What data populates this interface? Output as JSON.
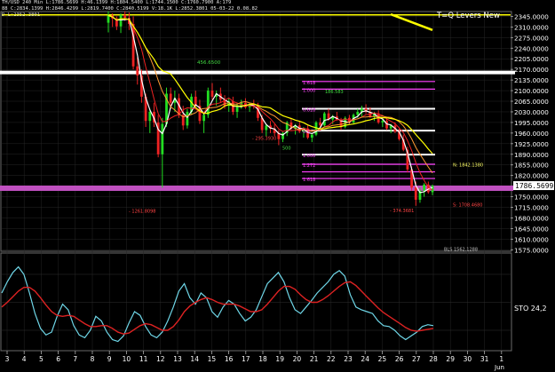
{
  "header": {
    "line1": "TH/USD 240 Min  L:1786.5699  H:46.1399  H:1804.5400  L:1744.1500  C:1760.7900  A:179",
    "line2": "88  C:2834.1399 H:2846.4299 L:2819.7400  C:2840.5199  V:18.1K  L:2852.3801  05-03-22  0.08.82",
    "line3": "D  L:2352.3801"
  },
  "chart_data": [
    {
      "type": "candlestick",
      "title": "",
      "y_ticks": [
        2345,
        2310,
        2275,
        2240,
        2205,
        2170,
        2135,
        2100,
        2065,
        2030,
        1995,
        1960,
        1925,
        1890,
        1855,
        1820,
        1786.5699,
        1750,
        1715,
        1680,
        1645,
        1610,
        1575
      ],
      "y_tick_labels": [
        "2345.0000",
        "2310.0000",
        "2275.0000",
        "2240.0000",
        "2205.0000",
        "2170.0000",
        "2135.0000",
        "2100.0000",
        "2065.0000",
        "2030.0000",
        "1995.0000",
        "1960.0000",
        "1925.0000",
        "1890.0000",
        "1855.0000",
        "1820.0000",
        "1786.5699",
        "1750.0000",
        "1715.0000",
        "1680.0000",
        "1645.0000",
        "1610.0000",
        "1575.0000"
      ],
      "ylim": [
        1570,
        2358
      ],
      "x_tick_labels": [
        "3",
        "4",
        "5",
        "6",
        "7",
        "8",
        "9",
        "10",
        "11",
        "12",
        "13",
        "14",
        "15",
        "16",
        "17",
        "18",
        "19",
        "20",
        "21",
        "22",
        "23",
        "24",
        "25",
        "26",
        "27",
        "28",
        "29",
        "30",
        "31",
        "1"
      ],
      "x_sub_label": "Jun",
      "price_tag": "1786.5699",
      "series": [
        {
          "values": [
            [
              2324,
              2362,
              2292,
              2348
            ],
            [
              2348,
              2355,
              2310,
              2338
            ],
            [
              2338,
              2345,
              2300,
              2312
            ],
            [
              2312,
              2355,
              2290,
              2350
            ],
            [
              2350,
              2362,
              2330,
              2340
            ],
            [
              2340,
              2358,
              2300,
              2320
            ],
            [
              2320,
              2345,
              2170,
              2180
            ],
            [
              2180,
              2210,
              2120,
              2150
            ],
            [
              2150,
              2170,
              2060,
              2080
            ],
            [
              2080,
              2090,
              1980,
              2000
            ],
            [
              2000,
              2040,
              1960,
              2030
            ],
            [
              2030,
              2060,
              1980,
              1995
            ],
            [
              1995,
              2020,
              1880,
              1890
            ],
            [
              1890,
              2010,
              1780,
              1990
            ],
            [
              1990,
              2110,
              1980,
              2090
            ],
            [
              2090,
              2110,
              2040,
              2060
            ],
            [
              2060,
              2100,
              2030,
              2075
            ],
            [
              2075,
              2090,
              2010,
              2020
            ],
            [
              2020,
              2050,
              1970,
              1985
            ],
            [
              1985,
              2040,
              1975,
              2030
            ],
            [
              2030,
              2090,
              2020,
              2080
            ],
            [
              2080,
              2100,
              2040,
              2050
            ],
            [
              2050,
              2070,
              1990,
              2000
            ],
            [
              2000,
              2030,
              1960,
              2020
            ],
            [
              2020,
              2110,
              2010,
              2100
            ],
            [
              2100,
              2125,
              2070,
              2080
            ],
            [
              2080,
              2100,
              2050,
              2090
            ],
            [
              2090,
              2110,
              2060,
              2070
            ],
            [
              2070,
              2085,
              2040,
              2050
            ],
            [
              2050,
              2075,
              2030,
              2065
            ],
            [
              2065,
              2080,
              2020,
              2030
            ],
            [
              2030,
              2060,
              2010,
              2050
            ],
            [
              2050,
              2070,
              2040,
              2060
            ],
            [
              2060,
              2075,
              2040,
              2045
            ],
            [
              2045,
              2060,
              2030,
              2055
            ],
            [
              2055,
              2070,
              2040,
              2050
            ],
            [
              2050,
              2060,
              2000,
              2010
            ],
            [
              2010,
              2020,
              1960,
              1970
            ],
            [
              1970,
              1990,
              1950,
              1985
            ],
            [
              1985,
              2000,
              1960,
              1975
            ],
            [
              1975,
              1990,
              1950,
              1960
            ],
            [
              1960,
              1970,
              1920,
              1940
            ],
            [
              1940,
              1965,
              1930,
              1960
            ],
            [
              1960,
              2000,
              1950,
              1995
            ],
            [
              1995,
              2010,
              1970,
              1975
            ],
            [
              1975,
              1990,
              1955,
              1985
            ],
            [
              1985,
              2000,
              1960,
              1965
            ],
            [
              1965,
              1980,
              1945,
              1975
            ],
            [
              1975,
              1985,
              1940,
              1945
            ],
            [
              1945,
              1960,
              1930,
              1955
            ],
            [
              1955,
              2000,
              1950,
              1995
            ],
            [
              1995,
              2010,
              1980,
              1985
            ],
            [
              1985,
              2030,
              1980,
              2025
            ],
            [
              2025,
              2040,
              2000,
              2005
            ],
            [
              2005,
              2020,
              1990,
              2015
            ],
            [
              2015,
              2030,
              2000,
              2005
            ],
            [
              2005,
              2010,
              1970,
              1980
            ],
            [
              1980,
              2015,
              1975,
              2010
            ],
            [
              2010,
              2020,
              1990,
              1995
            ],
            [
              1995,
              2025,
              1990,
              2020
            ],
            [
              2020,
              2040,
              2010,
              2030
            ],
            [
              2030,
              2050,
              2015,
              2040
            ],
            [
              2040,
              2055,
              2025,
              2030
            ],
            [
              2030,
              2045,
              2010,
              2015
            ],
            [
              2015,
              2030,
              2000,
              2025
            ],
            [
              2025,
              2035,
              1990,
              1995
            ],
            [
              1995,
              2005,
              1980,
              2000
            ],
            [
              2000,
              2010,
              1970,
              1975
            ],
            [
              1975,
              1990,
              1960,
              1985
            ],
            [
              1985,
              1995,
              1960,
              1965
            ],
            [
              1965,
              1975,
              1935,
              1940
            ],
            [
              1940,
              1955,
              1900,
              1905
            ],
            [
              1905,
              1915,
              1830,
              1840
            ],
            [
              1840,
              1850,
              1770,
              1780
            ],
            [
              1780,
              1800,
              1720,
              1740
            ],
            [
              1740,
              1780,
              1730,
              1770
            ],
            [
              1770,
              1795,
              1750,
              1790
            ],
            [
              1790,
              1800,
              1760,
              1765
            ],
            [
              1765,
              1790,
              1755,
              1786
            ]
          ]
        }
      ],
      "h_levels": [
        {
          "value": 2350,
          "color": "#ffff00"
        },
        {
          "value": 2160,
          "color": "#ffffff"
        },
        {
          "value": 2130,
          "color": "#ff40ff"
        },
        {
          "value": 2105,
          "color": "#ff40ff"
        },
        {
          "value": 2040,
          "color": "#ffffff"
        },
        {
          "value": 1968,
          "color": "#ffffff"
        },
        {
          "value": 1889,
          "color": "#ffffff"
        },
        {
          "value": 1857,
          "color": "#ff40ff"
        },
        {
          "value": 1832,
          "color": "#ff40ff"
        },
        {
          "value": 1810,
          "color": "#ff40ff"
        },
        {
          "value": 1778,
          "color": "#c050c0"
        }
      ],
      "annotations": [
        {
          "text": "T=Q Levers New",
          "color": "#ffffff"
        },
        {
          "text": "456.6500",
          "color": "#44dd44"
        },
        {
          "text": "1.618",
          "color": "#ff40ff"
        },
        {
          "text": "1.000",
          "color": "#ff40ff"
        },
        {
          "text": "0.618",
          "color": "#ff40ff"
        },
        {
          "text": "0.5",
          "color": "#ff40ff"
        },
        {
          "text": "1.000",
          "color": "#ff40ff"
        },
        {
          "text": "1.272",
          "color": "#ff40ff"
        },
        {
          "text": "1.618",
          "color": "#ff40ff"
        },
        {
          "text": "186.583",
          "color": "#44dd44"
        },
        {
          "text": "- 295.3930",
          "color": "#ff4444"
        },
        {
          "text": "- 1261.8098",
          "color": "#ff4444"
        },
        {
          "text": "- 374.3681",
          "color": "#ff4444"
        },
        {
          "text": "N: 1842.1380",
          "color": "#ffff66"
        },
        {
          "text": "S: 1708.4680",
          "color": "#ff4444"
        },
        {
          "text": "BLS 1562.1288",
          "color": "#bbbbbb"
        },
        {
          "text": "500",
          "color": "#44dd44"
        }
      ]
    },
    {
      "type": "line",
      "title": "",
      "xlabel": "",
      "ylabel": "",
      "ylim": [
        0,
        100
      ],
      "series_label_text": "STO 24,2",
      "series": [
        {
          "color": "#6fd7e8",
          "values": [
            60,
            72,
            82,
            88,
            80,
            60,
            38,
            22,
            15,
            18,
            35,
            48,
            42,
            25,
            15,
            12,
            20,
            35,
            30,
            18,
            10,
            8,
            14,
            28,
            40,
            36,
            24,
            15,
            12,
            18,
            30,
            45,
            62,
            70,
            55,
            48,
            60,
            55,
            40,
            34,
            45,
            52,
            48,
            38,
            30,
            34,
            42,
            56,
            70,
            76,
            82,
            72,
            55,
            42,
            38,
            45,
            52,
            60,
            66,
            72,
            80,
            84,
            78,
            58,
            45,
            42,
            40,
            38,
            30,
            25,
            24,
            20,
            14,
            10,
            14,
            18,
            24,
            26,
            25
          ]
        },
        {
          "color": "#dd2222",
          "values": [
            45,
            50,
            56,
            62,
            66,
            66,
            62,
            55,
            47,
            40,
            36,
            35,
            36,
            35,
            31,
            27,
            24,
            24,
            25,
            25,
            22,
            18,
            16,
            17,
            21,
            25,
            27,
            26,
            23,
            20,
            20,
            24,
            31,
            40,
            46,
            50,
            53,
            55,
            53,
            50,
            48,
            48,
            48,
            46,
            43,
            40,
            40,
            42,
            48,
            55,
            62,
            67,
            67,
            64,
            58,
            53,
            50,
            50,
            53,
            57,
            62,
            67,
            71,
            72,
            68,
            62,
            56,
            50,
            44,
            39,
            35,
            31,
            27,
            23,
            20,
            19,
            20,
            21,
            22
          ]
        }
      ]
    }
  ]
}
